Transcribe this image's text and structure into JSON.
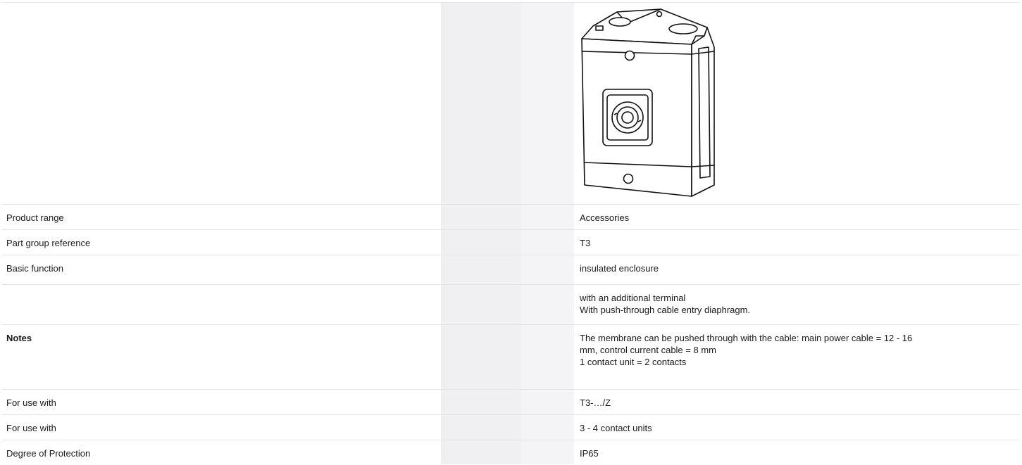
{
  "rows": [
    {
      "label": "Product range",
      "values": [
        "Accessories"
      ],
      "bold": false
    },
    {
      "label": "Part group reference",
      "values": [
        "T3"
      ],
      "bold": false
    },
    {
      "label": "Basic function",
      "values": [
        "insulated enclosure"
      ],
      "bold": false
    },
    {
      "label": "",
      "values": [
        "with an additional terminal",
        "With push-through cable entry diaphragm."
      ],
      "bold": false
    },
    {
      "label": "Notes",
      "values": [
        "The membrane can be pushed through with the cable: main power cable = 12 - 16",
        "mm, control current cable = 8 mm",
        "1 contact unit = 2 contacts"
      ],
      "bold": true
    },
    {
      "label": "For use with",
      "values": [
        "T3-…/Z"
      ],
      "bold": false
    },
    {
      "label": "For use with",
      "values": [
        "3 - 4 contact units"
      ],
      "bold": false
    },
    {
      "label": "Degree of Protection",
      "values": [
        "IP65"
      ],
      "bold": false
    }
  ],
  "product_image_icon": "enclosure-product-drawing"
}
